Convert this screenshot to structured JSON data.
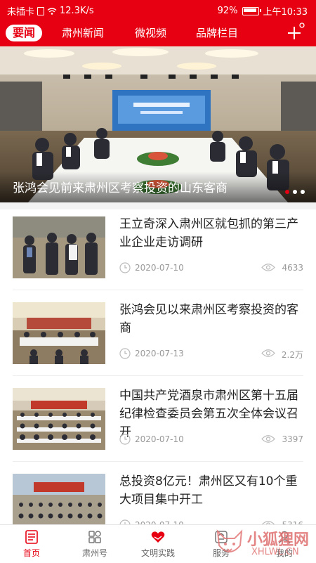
{
  "status_bar": {
    "carrier": "未插卡",
    "speed": "12.3K/s",
    "battery": "92%",
    "time": "上午10:33"
  },
  "tabs": [
    {
      "label": "要闻",
      "active": true
    },
    {
      "label": "肃州新闻",
      "active": false
    },
    {
      "label": "微视频",
      "active": false
    },
    {
      "label": "品牌栏目",
      "active": false
    }
  ],
  "banner": {
    "caption": "张鸿会见前来肃州区考察投资的山东客商",
    "slide_count": 3,
    "active_slide": 1
  },
  "news": [
    {
      "title": "王立奇深入肃州区就包抓的第三产业企业走访调研",
      "date": "2020-07-10",
      "views": "4633"
    },
    {
      "title": "张鸿会见以来肃州区考察投资的客商",
      "date": "2020-07-13",
      "views": "2.2万"
    },
    {
      "title": "中国共产党酒泉市肃州区第十五届纪律检查委员会第五次全体会议召开",
      "date": "2020-07-10",
      "views": "3397"
    },
    {
      "title": "总投资8亿元！肃州区又有10个重大项目集中开工",
      "date": "2020-07-10",
      "views": "5316"
    }
  ],
  "bottom_nav": [
    {
      "label": "首页",
      "icon": "home-icon",
      "active": true
    },
    {
      "label": "肃州号",
      "icon": "grid-icon",
      "active": false
    },
    {
      "label": "文明实践",
      "icon": "heart-hands-icon",
      "active": false
    },
    {
      "label": "服务",
      "icon": "service-icon",
      "active": false
    },
    {
      "label": "我的",
      "icon": "user-icon",
      "active": false
    }
  ],
  "watermark": {
    "text": "小狐狸网",
    "sub": "XHLWL.CN"
  },
  "colors": {
    "accent": "#e60012",
    "muted": "#999999"
  }
}
